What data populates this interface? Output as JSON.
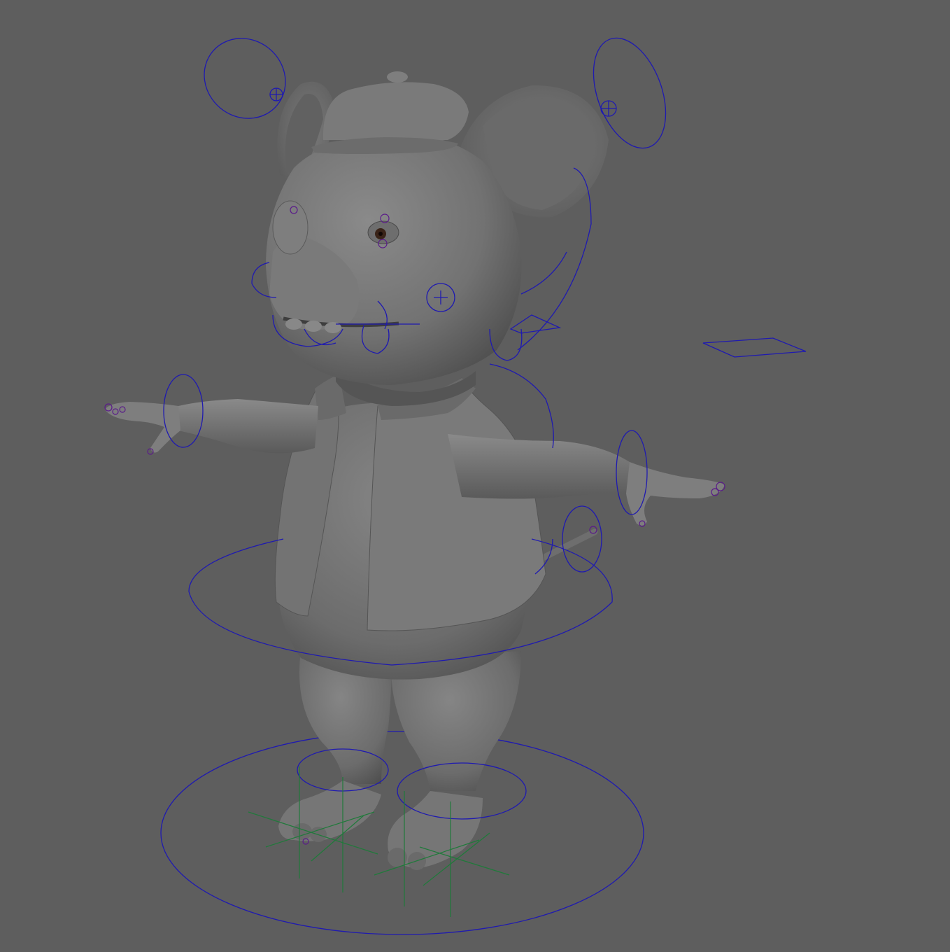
{
  "viewport": {
    "background": "#5e5e5e",
    "mesh_color": "#7b7b7b",
    "control_color": "#1f1ab0",
    "joint_color": "#5a1a8a",
    "ik_color": "#1f7a3a"
  }
}
